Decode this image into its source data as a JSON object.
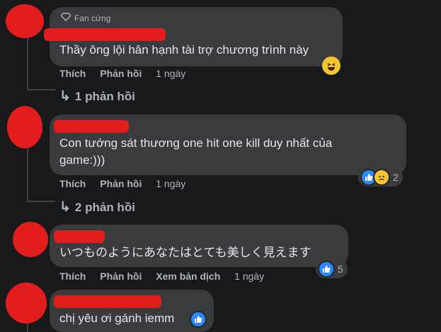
{
  "comments": [
    {
      "badge": "Fan cứng",
      "text": "Thầy ông lội hân hạnh tài trợ chương trình này",
      "actions": [
        "Thích",
        "Phản hồi"
      ],
      "time": "1 ngày",
      "replies": "1 phản hồi",
      "reaction_icons": [
        "laughing-emoji-icon"
      ]
    },
    {
      "text_lines": [
        "Con tướng sát thương one hit one kill duy nhất của",
        "game:)))"
      ],
      "actions": [
        "Thích",
        "Phản hồi"
      ],
      "time": "1 ngày",
      "replies": "2 phản hồi",
      "reaction_icons": [
        "like-icon",
        "sad-emoji-icon"
      ],
      "reaction_count": "2"
    },
    {
      "text": "いつものようにあなたはとても美しく見えます",
      "actions": [
        "Thích",
        "Phản hồi",
        "Xem bản dịch"
      ],
      "time": "1 ngày",
      "reaction_icons": [
        "like-icon"
      ],
      "reaction_count": "5"
    },
    {
      "text": "chị yêu ơi gánh iemm",
      "inline_reaction": "like-icon"
    }
  ],
  "colors": {
    "background": "#18191a",
    "bubble": "#3a3b3c",
    "like": "#2d88ff",
    "redaction": "#e11d1d"
  }
}
